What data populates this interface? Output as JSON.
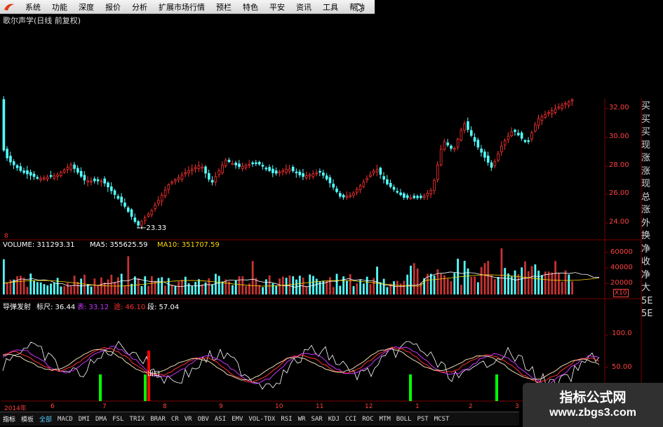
{
  "menu": {
    "items": [
      "系统",
      "功能",
      "深度",
      "报价",
      "分析",
      "扩展市场行情",
      "预栏",
      "特色",
      "平安",
      "资讯",
      "工具",
      "帮助"
    ]
  },
  "header": {
    "title": "歌尔声学(日线 前复权)"
  },
  "price_panel": {
    "low_marker": "←23.33",
    "small_label": "8",
    "y_ticks": [
      "32.00",
      "30.00",
      "28.00",
      "26.00",
      "24.00"
    ]
  },
  "volume_panel": {
    "label_volume": "VOLUME: 311293.31",
    "label_ma5": "MA5: 355625.59",
    "label_ma10": "MA10: 351707.59",
    "y_ticks": [
      "60000",
      "40000",
      "20000"
    ],
    "unit": "X10"
  },
  "indicator_panel": {
    "name": "导弹发射",
    "biaochi": "标尺: 36.44",
    "biao": "表: 33.12",
    "lu": "途: 46.10",
    "duan": "段: 57.04",
    "signal_text": "出口",
    "y_ticks": [
      "100.0",
      "50.00"
    ]
  },
  "date_axis": {
    "labels": [
      "2014年",
      "6",
      "7",
      "8",
      "9",
      "10",
      "11",
      "12",
      "1",
      "2",
      "3"
    ]
  },
  "right_column": {
    "chars": [
      "买",
      "买",
      "买",
      "现",
      "涨",
      "涨",
      "现",
      "总",
      "涨",
      "外",
      "换",
      "净",
      "收",
      "净",
      "大",
      "5E",
      "5E"
    ]
  },
  "bottom_tabs": [
    "指标",
    "模板",
    "全部",
    "MACD",
    "DMI",
    "DMA",
    "FSL",
    "TRIX",
    "BRAR",
    "CR",
    "VR",
    "OBV",
    "ASI",
    "EMV",
    "VOL-TDX",
    "RSI",
    "WR",
    "SAR",
    "KDJ",
    "CCI",
    "ROC",
    "MTM",
    "BOLL",
    "PST",
    "MCST"
  ],
  "watermark": {
    "title": "指标公式网",
    "url": "www.zbgs3.com"
  },
  "colors": {
    "up": "#ff3232",
    "down": "#54ffff",
    "grid": "#7a0000",
    "ma5": "#ffffff",
    "ma10": "#ffd700",
    "signal_green": "#00ff00",
    "signal_red": "#ff0000",
    "purple": "#cc33ff"
  }
}
